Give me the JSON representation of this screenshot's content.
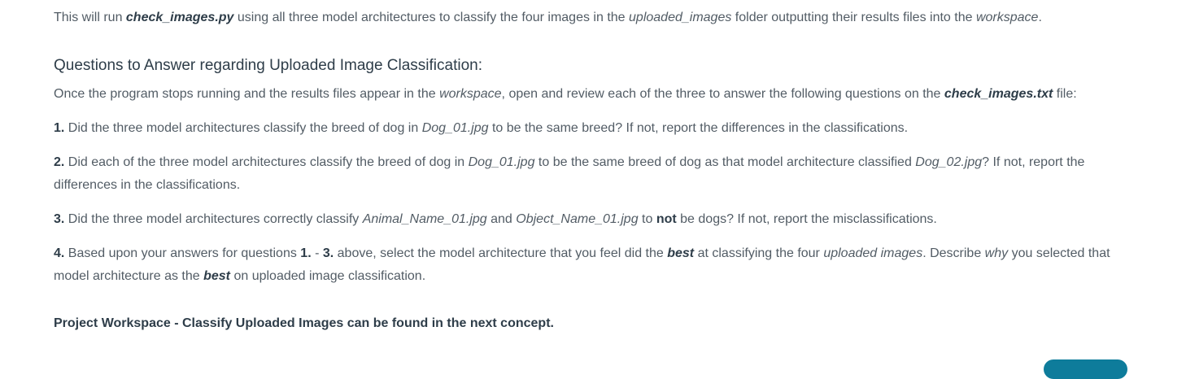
{
  "intro": {
    "t1": "This will run ",
    "script": "check_images.py",
    "t2": " using all three model architectures to classify the four images in the ",
    "folder": "uploaded_images",
    "t3": " folder outputting their results files into the ",
    "workspace": "workspace",
    "t4": "."
  },
  "heading": "Questions to Answer regarding Uploaded Image Classification:",
  "lead": {
    "t1": "Once the program stops running and the results files appear in the ",
    "workspace": "workspace",
    "t2": ", open and review each of the three to answer the following questions on the ",
    "file": "check_images.txt",
    "t3": " file:"
  },
  "questions": {
    "q1": {
      "num": "1.",
      "t1": " Did the three model architectures classify the breed of dog in ",
      "file": "Dog_01.jpg",
      "t2": " to be the same breed? If not, report the differences in the classifications."
    },
    "q2": {
      "num": "2.",
      "t1": " Did each of the three model architectures classify the breed of dog in ",
      "file1": "Dog_01.jpg",
      "t2": " to be the same breed of dog as that model architecture classified ",
      "file2": "Dog_02.jpg",
      "t3": "? If not, report the differences in the classifications."
    },
    "q3": {
      "num": "3.",
      "t1": " Did the three model architectures correctly classify ",
      "file1": "Animal_Name_01.jpg",
      "t2": " and ",
      "file2": "Object_Name_01.jpg",
      "t3": " to ",
      "not": "not",
      "t4": " be dogs? If not, report the misclassifications."
    },
    "q4": {
      "num": "4.",
      "t1": " Based upon your answers for questions ",
      "ref1": "1.",
      "t2": " - ",
      "ref2": "3.",
      "t3": " above, select the model architecture that you feel did the ",
      "best1": "best",
      "t4": " at classifying the four ",
      "uploaded": "uploaded images",
      "t5": ". Describe ",
      "why": "why",
      "t6": " you selected that model architecture as the ",
      "best2": "best",
      "t7": " on uploaded image classification."
    }
  },
  "footer_note": "Project Workspace - Classify Uploaded Images can be found in the next concept.",
  "colors": {
    "text": "#525c65",
    "heading": "#2e3d49",
    "button": "#0e7c9b"
  }
}
